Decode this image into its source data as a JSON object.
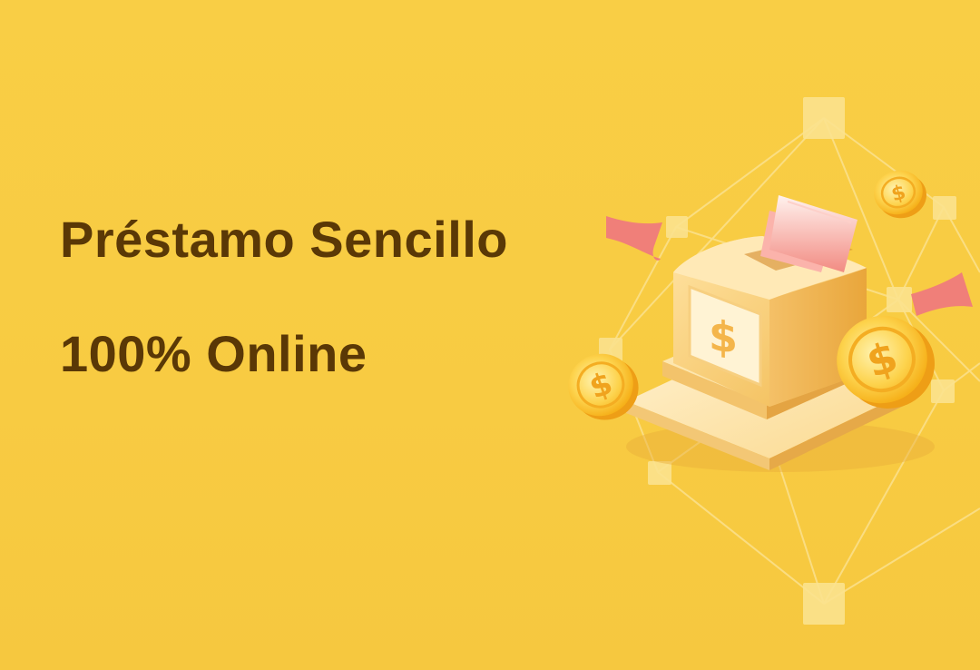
{
  "banner": {
    "title_line_1": "Préstamo Sencillo",
    "title_line_2": "100% Online",
    "illustration_icon": "cash-register-with-coins-icon",
    "colors": {
      "background": "#f8cb42",
      "text": "#5a3806",
      "coin": "#fbc02d",
      "paper": "#f28b82"
    }
  }
}
